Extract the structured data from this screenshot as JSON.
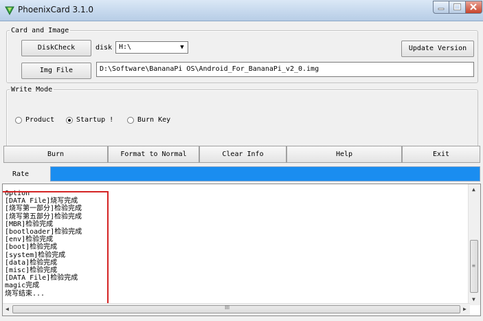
{
  "window": {
    "title": "PhoenixCard 3.1.0"
  },
  "card_group": {
    "legend": "Card and Image",
    "diskcheck_label": "DiskCheck",
    "disk_label": "disk",
    "disk_value": "H:\\",
    "update_label": "Update Version",
    "img_file_label": "Img File",
    "img_path": "D:\\Software\\BananaPi OS\\Android_For_BananaPi_v2_0.img"
  },
  "write_mode": {
    "legend": "Write Mode",
    "options": [
      {
        "label": "Product",
        "checked": false
      },
      {
        "label": "Startup !",
        "checked": true
      },
      {
        "label": "Burn Key",
        "checked": false
      }
    ]
  },
  "actions": {
    "burn": "Burn",
    "format": "Format to Normal",
    "clear": "Clear Info",
    "help": "Help",
    "exit": "Exit"
  },
  "rate": {
    "label": "Rate",
    "progress": 1.0
  },
  "log": {
    "lines": [
      "Option",
      "[DATA File]烧写完成",
      "[烧写第一部分]检验完成",
      "[烧写第五部分]检验完成",
      "[MBR]检验完成",
      "[bootloader]检验完成",
      "[env]检验完成",
      "[boot]检验完成",
      "[system]检验完成",
      "[data]检验完成",
      "[misc]检验完成",
      "[DATA File]检验完成",
      "magic完成",
      "烧写结束..."
    ],
    "scroll_h_label": "III"
  },
  "colors": {
    "progress": "#1a8df0",
    "highlight": "#d42323"
  },
  "icons": {
    "app": "phoenix-card-icon",
    "minimize": "minimize-icon",
    "maximize": "maximize-icon",
    "close": "close-icon"
  }
}
